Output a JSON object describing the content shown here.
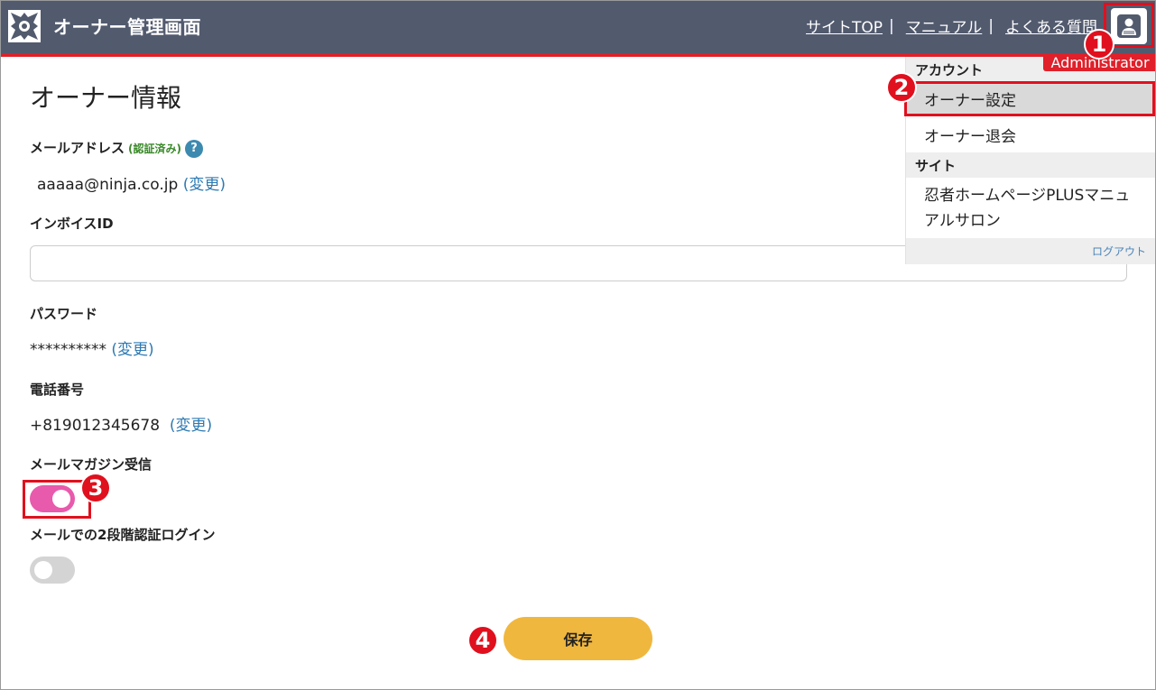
{
  "header": {
    "app_title": "オーナー管理画面",
    "nav": [
      {
        "label": "サイトTOP",
        "sep": "|"
      },
      {
        "label": "マニュアル",
        "sep": "|"
      },
      {
        "label": "よくある質問",
        "sep": ""
      }
    ],
    "user_badge": "Administrator"
  },
  "page": {
    "title": "オーナー情報"
  },
  "fields": {
    "email_label": "メールアドレス",
    "email_verified": "(認証済み)",
    "help_icon": "?",
    "email_value": "aaaaa@ninja.co.jp",
    "email_change": "(変更)",
    "invoice_label": "インボイスID",
    "invoice_value": "",
    "password_label": "パスワード",
    "password_value": "**********",
    "password_change": "(変更)",
    "phone_label": "電話番号",
    "phone_value": "+819012345678",
    "phone_change": "(変更)",
    "newsletter_label": "メールマガジン受信",
    "newsletter_on": true,
    "twofa_label": "メールでの2段階認証ログイン",
    "twofa_on": false
  },
  "save_label": "保存",
  "dropdown": {
    "section_account": "アカウント",
    "owner_settings": "オーナー設定",
    "owner_withdraw": "オーナー退会",
    "section_site": "サイト",
    "manual_salon_line1": "忍者ホームページPLUSマニュ",
    "manual_salon_line2": "アルサロン",
    "logout": "ログアウト"
  },
  "callouts": [
    "1",
    "2",
    "3",
    "4"
  ],
  "colors": {
    "header_bg": "#525a6e",
    "accent_red": "#e0202a",
    "toggle_on": "#e85aac",
    "save_button": "#f0b73e",
    "link": "#2e7ab2"
  }
}
